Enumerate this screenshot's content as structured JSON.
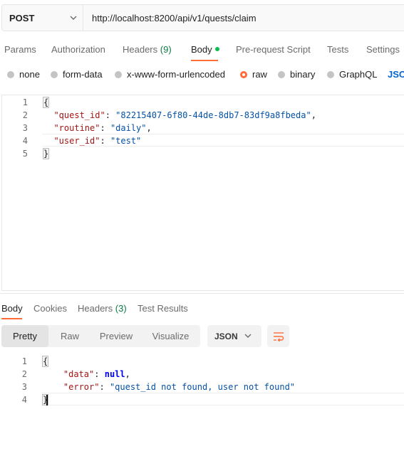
{
  "request": {
    "method": "POST",
    "url": "http://localhost:8200/api/v1/quests/claim"
  },
  "request_tabs": [
    {
      "label": "Params"
    },
    {
      "label": "Authorization"
    },
    {
      "label": "Headers",
      "count": "(9)"
    },
    {
      "label": "Body",
      "active": true,
      "indicator_dot": true
    },
    {
      "label": "Pre-request Script"
    },
    {
      "label": "Tests"
    },
    {
      "label": "Settings"
    }
  ],
  "body_types": [
    {
      "label": "none"
    },
    {
      "label": "form-data"
    },
    {
      "label": "x-www-form-urlencoded"
    },
    {
      "label": "raw",
      "selected": true
    },
    {
      "label": "binary"
    },
    {
      "label": "GraphQL"
    }
  ],
  "raw_format_link": "JSO",
  "request_body": {
    "line_numbers": [
      "1",
      "2",
      "3",
      "4",
      "5"
    ],
    "open_brace": "{",
    "close_brace": "}",
    "fields": [
      {
        "key": "\"quest_id\"",
        "value": "\"82215407-6f80-44de-8db7-83df9a8fbeda\"",
        "trailing": ","
      },
      {
        "key": "\"routine\"",
        "value": "\"daily\"",
        "trailing": ","
      },
      {
        "key": "\"user_id\"",
        "value": "\"test\"",
        "trailing": ""
      }
    ]
  },
  "response_tabs": [
    {
      "label": "Body",
      "active": true
    },
    {
      "label": "Cookies"
    },
    {
      "label": "Headers",
      "count": "(3)"
    },
    {
      "label": "Test Results"
    }
  ],
  "view_modes": [
    {
      "label": "Pretty",
      "active": true
    },
    {
      "label": "Raw"
    },
    {
      "label": "Preview"
    },
    {
      "label": "Visualize"
    }
  ],
  "response_format": "JSON",
  "response_body": {
    "line_numbers": [
      "1",
      "2",
      "3",
      "4"
    ],
    "open_brace": "{",
    "close_brace": "}",
    "fields": [
      {
        "key": "\"data\"",
        "value": "null",
        "trailing": ","
      },
      {
        "key": "\"error\"",
        "value": "\"quest_id not found, user not found\"",
        "trailing": ""
      }
    ]
  },
  "colors": {
    "accent": "#ff6c37",
    "indicator": "#0cbb52",
    "count": "#0c7a43",
    "link": "#0265d2",
    "json_key": "#a31515",
    "json_string": "#0451a5"
  }
}
